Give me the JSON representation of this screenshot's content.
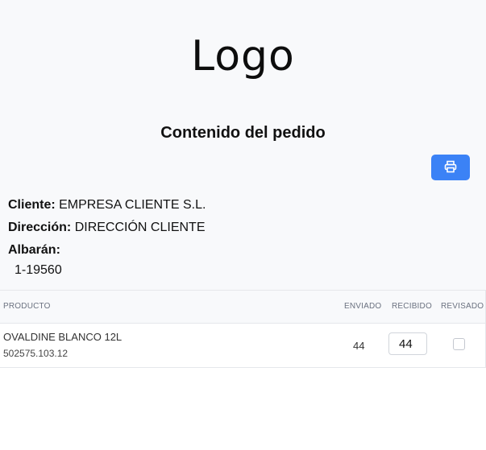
{
  "header": {
    "logo": "Logo",
    "title": "Contenido del pedido",
    "print_icon": "printer-icon"
  },
  "info": {
    "cliente_label": "Cliente:",
    "cliente_value": "EMPRESA CLIENTE S.L.",
    "direccion_label": "Dirección:",
    "direccion_value": "DIRECCIÓN CLIENTE",
    "albaran_label": "Albarán:",
    "albaran_value": "1-19560"
  },
  "table": {
    "headers": {
      "producto": "PRODUCTO",
      "enviado": "ENVIADO",
      "recibido": "RECIBIDO",
      "revisado": "REVISADO"
    },
    "rows": [
      {
        "name": "OVALDINE BLANCO 12L",
        "code": "502575.103.12",
        "enviado": "44",
        "recibido": "44",
        "revisado": false
      }
    ]
  },
  "colors": {
    "accent": "#3b82f6",
    "background": "#f8f9fb"
  }
}
